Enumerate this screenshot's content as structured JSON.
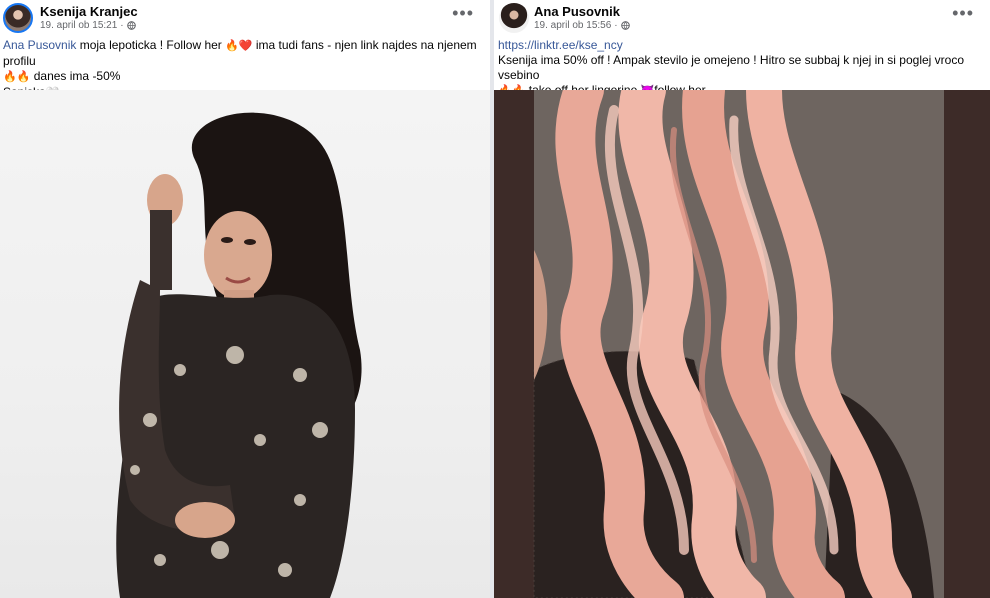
{
  "posts": [
    {
      "author": "Ksenija Kranjec",
      "timestamp": "19. april ob 15:21",
      "privacy_icon": "globe-icon",
      "more_icon": "more-horizontal-icon",
      "text": {
        "mention": "Ana Pusovnik",
        "line1_rest": " moja lepoticka ! Follow her ",
        "line1_emojis": "🔥❤️",
        "line1_tail": " ima tudi fans - njen link najdes na njenem profilu",
        "line2_emojis": "🔥🔥",
        "line2_text": " danes ima -50%",
        "line3_text": "Sanjska",
        "line3_emoji": "🤍"
      },
      "photo": {
        "description_icon": "photo-icon",
        "background": "#f2f2f2"
      }
    },
    {
      "author": "Ana Pusovnik",
      "timestamp": "19. april ob 15:56",
      "privacy_icon": "globe-icon",
      "more_icon": "more-horizontal-icon",
      "text": {
        "link": "https://linktr.ee/kse_ncy",
        "line2_text": "Ksenija ima 50% off ! Ampak stevilo je omejeno ! Hitro se subbaj k njej in si poglej vroco vsebino",
        "line3_emojis": "🔥🔥",
        "line3_text": " take off her lingerine ",
        "line3_emoji2": "😈",
        "line3_tail": "follow her"
      },
      "photo": {
        "description_icon": "photo-icon",
        "background": "#4a3633"
      }
    }
  ],
  "colors": {
    "link": "#385898",
    "name": "#050505",
    "meta": "#65676b",
    "avatar_ring": "#1877f2",
    "divider": "#e4e6eb"
  }
}
